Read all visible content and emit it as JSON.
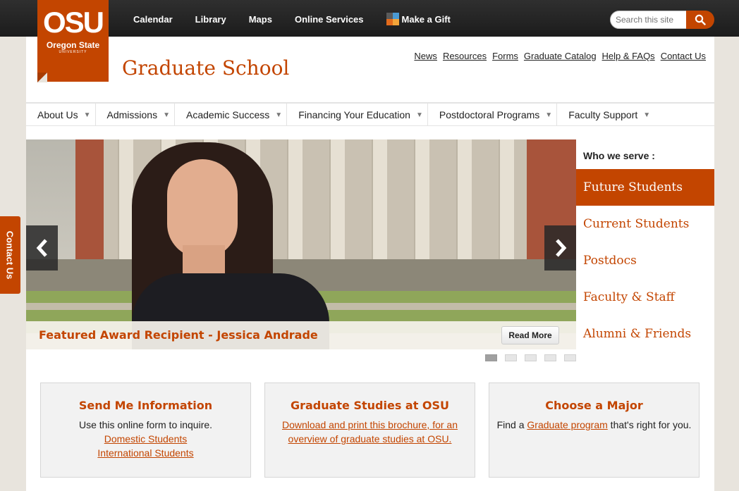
{
  "toplinks": {
    "calendar": "Calendar",
    "library": "Library",
    "maps": "Maps",
    "online_services": "Online Services",
    "make_gift": "Make a Gift"
  },
  "search": {
    "placeholder": "Search this site"
  },
  "logo": {
    "line1": "OSU",
    "line2": "Oregon State",
    "line3": "UNIVERSITY"
  },
  "site_title": "Graduate School",
  "utility": [
    "News",
    "Resources",
    "Forms",
    "Graduate Catalog",
    "Help & FAQs",
    "Contact Us"
  ],
  "nav": [
    "About Us",
    "Admissions",
    "Academic Success",
    "Financing Your Education",
    "Postdoctoral Programs",
    "Faculty Support"
  ],
  "slider": {
    "caption": "Featured Award Recipient - Jessica Andrade",
    "read_more": "Read More",
    "dot_count": 5,
    "active_dot": 1
  },
  "serve": {
    "heading": "Who we serve :",
    "items": [
      "Future Students",
      "Current Students",
      "Postdocs",
      "Faculty & Staff",
      "Alumni & Friends"
    ],
    "active_index": 0
  },
  "contact_tab": "Contact Us",
  "boxes": {
    "info": {
      "title": "Send Me Information",
      "text": "Use this online form to inquire.",
      "link1": "Domestic Students",
      "link2": "International Students"
    },
    "studies": {
      "title": "Graduate Studies at OSU",
      "link": "Download and print this brochure, for an overview of graduate studies at OSU."
    },
    "major": {
      "title": "Choose a Major",
      "text_before": "Find a ",
      "link": "Graduate program",
      "text_after": " that's right for you."
    }
  },
  "colors": {
    "accent": "#c34500",
    "topbar": "#222222",
    "background": "#e8e4dd"
  }
}
